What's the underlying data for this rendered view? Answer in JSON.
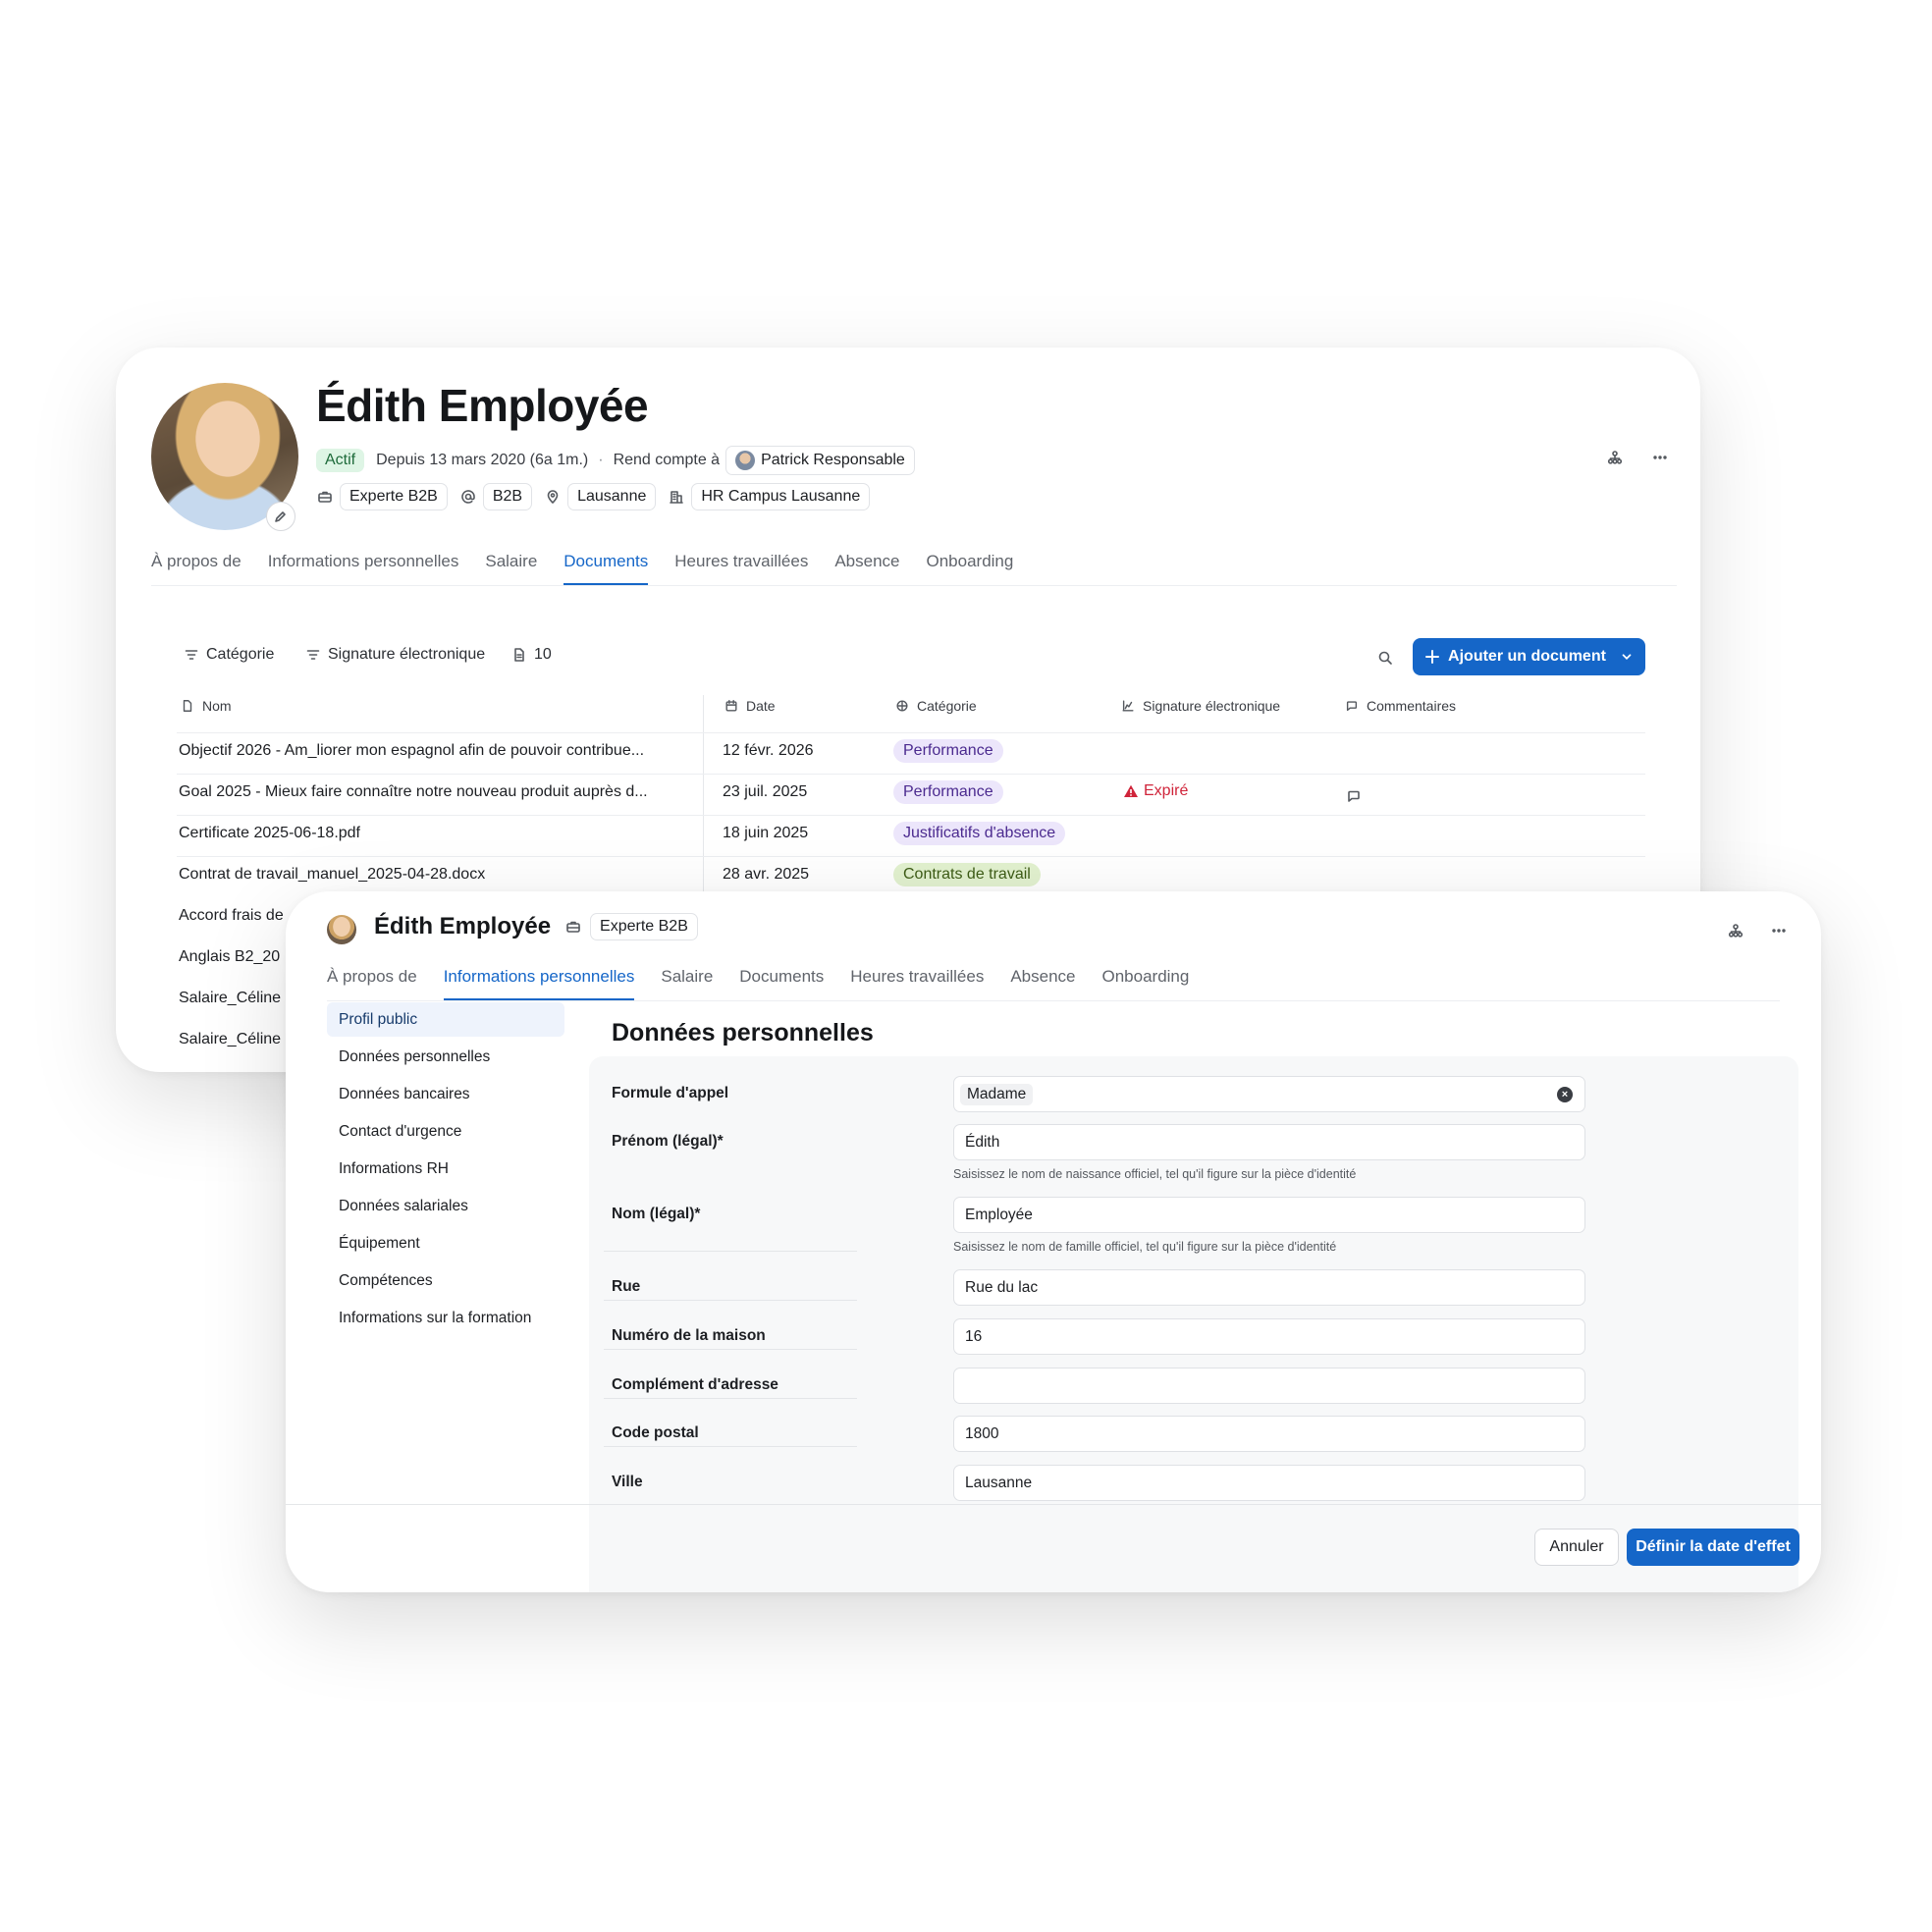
{
  "back": {
    "name": "Édith Employée",
    "status": "Actif",
    "since": "Depuis 13 mars 2020 (6a 1m.)",
    "separator": "·",
    "reports_to_label": "Rend compte à",
    "manager": "Patrick Responsable",
    "chips": [
      "Experte B2B",
      "B2B",
      "Lausanne",
      "HR Campus Lausanne"
    ],
    "tabs": [
      "À propos de",
      "Informations personnelles",
      "Salaire",
      "Documents",
      "Heures travaillées",
      "Absence",
      "Onboarding"
    ],
    "active_tab": "Documents",
    "toolbar": {
      "filter_category": "Catégorie",
      "filter_signature": "Signature électronique",
      "doc_count": "10",
      "add_document": "Ajouter un document"
    },
    "table": {
      "headers": [
        "Nom",
        "Date",
        "Catégorie",
        "Signature électronique",
        "Commentaires"
      ],
      "rows": [
        {
          "name": "Objectif 2026 - Am_liorer mon espagnol afin de pouvoir contribue...",
          "date": "12 févr. 2026",
          "category": "Performance",
          "signature": "",
          "comment": false
        },
        {
          "name": "Goal 2025 - Mieux faire connaître notre nouveau produit auprès d...",
          "date": "23 juil. 2025",
          "category": "Performance",
          "signature": "Expiré",
          "comment": true
        },
        {
          "name": "Certificate 2025-06-18.pdf",
          "date": "18 juin 2025",
          "category": "Justificatifs d'absence",
          "signature": "",
          "comment": false
        },
        {
          "name": "Contrat de travail_manuel_2025-04-28.docx",
          "date": "28 avr. 2025",
          "category": "Contrats de travail",
          "signature": "",
          "comment": false
        },
        {
          "name": "Accord frais de",
          "date": "",
          "category": "",
          "signature": "",
          "comment": false
        },
        {
          "name": "Anglais B2_20",
          "date": "",
          "category": "",
          "signature": "",
          "comment": false
        },
        {
          "name": "Salaire_Céline",
          "date": "",
          "category": "",
          "signature": "",
          "comment": false
        },
        {
          "name": "Salaire_Céline",
          "date": "",
          "category": "",
          "signature": "",
          "comment": false
        }
      ]
    }
  },
  "front": {
    "name": "Édith Employée",
    "role": "Experte B2B",
    "tabs": [
      "À propos de",
      "Informations personnelles",
      "Salaire",
      "Documents",
      "Heures travaillées",
      "Absence",
      "Onboarding"
    ],
    "active_tab": "Informations personnelles",
    "sidebar": [
      "Profil public",
      "Données personnelles",
      "Données bancaires",
      "Contact d'urgence",
      "Informations RH",
      "Données salariales",
      "Équipement",
      "Compétences",
      "Informations sur la formation"
    ],
    "form_title": "Données personnelles",
    "fields": {
      "salutation": {
        "label": "Formule d'appel",
        "value": "Madame"
      },
      "first_name": {
        "label": "Prénom (légal)*",
        "value": "Édith",
        "help": "Saisissez le nom de naissance officiel, tel qu'il figure sur la pièce d'identité"
      },
      "last_name": {
        "label": "Nom (légal)*",
        "value": "Employée",
        "help": "Saisissez le nom de famille officiel, tel qu'il figure sur la pièce d'identité"
      },
      "street": {
        "label": "Rue",
        "value": "Rue du lac"
      },
      "house_number": {
        "label": "Numéro de la maison",
        "value": "16"
      },
      "address_extra": {
        "label": "Complément d'adresse",
        "value": ""
      },
      "postal_code": {
        "label": "Code postal",
        "value": "1800"
      },
      "city": {
        "label": "Ville",
        "value": "Lausanne"
      }
    },
    "footer": {
      "cancel": "Annuler",
      "confirm": "Définir la date d'effet"
    }
  },
  "colors": {
    "accent": "#1566c8",
    "active_badge": "#def5e5",
    "expired": "#d0243a",
    "pill_purple": "#ece6fb",
    "pill_green": "#e2f1cf"
  }
}
